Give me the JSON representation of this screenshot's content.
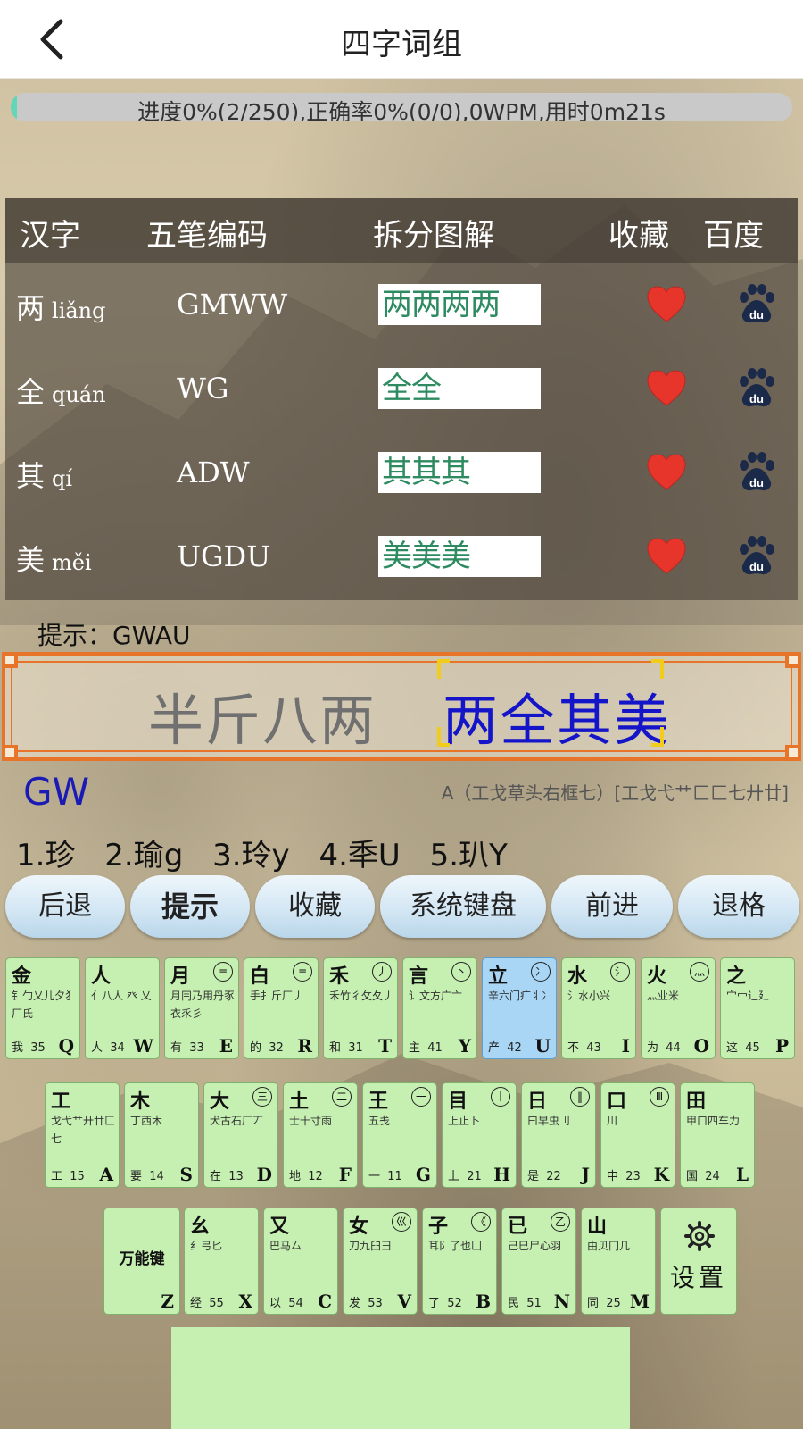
{
  "header": {
    "title": "四字词组"
  },
  "progress": {
    "text": "进度0%(2/250),正确率0%(0/0),0WPM,用时0m21s",
    "fraction": 0.008,
    "fill_color": "#62d6b7"
  },
  "table": {
    "headers": [
      "汉字",
      "五笔编码",
      "拆分图解",
      "收藏",
      "百度"
    ],
    "rows": [
      {
        "char": "两",
        "pinyin": "liǎng",
        "code": "GMWW",
        "parts": "两两两两"
      },
      {
        "char": "全",
        "pinyin": "quán",
        "code": "WG",
        "parts": "全全"
      },
      {
        "char": "其",
        "pinyin": "qí",
        "code": "ADW",
        "parts": "其其其"
      },
      {
        "char": "美",
        "pinyin": "měi",
        "code": "UGDU",
        "parts": "美美美"
      }
    ],
    "favorite_icon": "heart-icon",
    "baidu_icon": "baidu-paw-icon"
  },
  "hint": "提示：GWAU",
  "phrase": {
    "previous": "半斤八两",
    "current": "两全其美"
  },
  "input": {
    "typed": "GW",
    "root_hint": "A（工戈草头右框七）[工戈弋艹匚匚七廾廿]",
    "candidates": [
      "1.珍",
      "2.瑜g",
      "3.玲y",
      "4.秊U",
      "5.玐Y"
    ]
  },
  "actions": [
    "后退",
    "提示",
    "收藏",
    "系统键盘",
    "前进",
    "退格"
  ],
  "keyboard": {
    "row1": [
      {
        "name": "金",
        "circ": "",
        "roots": "钅勹乂儿夕犭厂氏",
        "foot": "我",
        "num": "35",
        "letter": "Q"
      },
      {
        "name": "人",
        "circ": "",
        "roots": "亻八人 癶 乂",
        "foot": "人",
        "num": "34",
        "letter": "W"
      },
      {
        "name": "月",
        "circ": "≡",
        "roots": "月冃乃用丹豕衣乑彡",
        "foot": "有",
        "num": "33",
        "letter": "E"
      },
      {
        "name": "白",
        "circ": "≡",
        "roots": "手扌斤厂丿",
        "foot": "的",
        "num": "32",
        "letter": "R"
      },
      {
        "name": "禾",
        "circ": "丿",
        "roots": "禾竹彳攵夂丿",
        "foot": "和",
        "num": "31",
        "letter": "T"
      },
      {
        "name": "言",
        "circ": "丶",
        "roots": "讠文方广亠",
        "foot": "主",
        "num": "41",
        "letter": "Y"
      },
      {
        "name": "立",
        "circ": "冫",
        "roots": "辛六门疒丬冫",
        "foot": "产",
        "num": "42",
        "letter": "U"
      },
      {
        "name": "水",
        "circ": "氵",
        "roots": "氵水小兴",
        "foot": "不",
        "num": "43",
        "letter": "I"
      },
      {
        "name": "火",
        "circ": "灬",
        "roots": "灬业米",
        "foot": "为",
        "num": "44",
        "letter": "O"
      },
      {
        "name": "之",
        "circ": "",
        "roots": "宀冖辶廴",
        "foot": "这",
        "num": "45",
        "letter": "P"
      }
    ],
    "row2": [
      {
        "name": "工",
        "circ": "",
        "roots": "戈弋艹廾廿匚七",
        "foot": "工",
        "num": "15",
        "letter": "A"
      },
      {
        "name": "木",
        "circ": "",
        "roots": "丁西木",
        "foot": "要",
        "num": "14",
        "letter": "S"
      },
      {
        "name": "大",
        "circ": "三",
        "roots": "犬古石厂丆",
        "foot": "在",
        "num": "13",
        "letter": "D"
      },
      {
        "name": "土",
        "circ": "二",
        "roots": "士十寸雨",
        "foot": "地",
        "num": "12",
        "letter": "F"
      },
      {
        "name": "王",
        "circ": "一",
        "roots": "五戋",
        "foot": "一",
        "num": "11",
        "letter": "G"
      },
      {
        "name": "目",
        "circ": "丨",
        "roots": "上止卜",
        "foot": "上",
        "num": "21",
        "letter": "H"
      },
      {
        "name": "日",
        "circ": "‖",
        "roots": "曰早虫刂",
        "foot": "是",
        "num": "22",
        "letter": "J"
      },
      {
        "name": "口",
        "circ": "Ⅲ",
        "roots": "川",
        "foot": "中",
        "num": "23",
        "letter": "K"
      },
      {
        "name": "田",
        "circ": "",
        "roots": "甲口四车力",
        "foot": "国",
        "num": "24",
        "letter": "L"
      }
    ],
    "row3": [
      {
        "name": "幺",
        "circ": "",
        "roots": "纟弓匕",
        "foot": "经",
        "num": "55",
        "letter": "X"
      },
      {
        "name": "又",
        "circ": "",
        "roots": "巴马厶",
        "foot": "以",
        "num": "54",
        "letter": "C"
      },
      {
        "name": "女",
        "circ": "巛",
        "roots": "刀九臼彐",
        "foot": "发",
        "num": "53",
        "letter": "V"
      },
      {
        "name": "子",
        "circ": "《",
        "roots": "耳阝了也凵",
        "foot": "了",
        "num": "52",
        "letter": "B"
      },
      {
        "name": "已",
        "circ": "乙",
        "roots": "己巳尸心羽",
        "foot": "民",
        "num": "51",
        "letter": "N"
      },
      {
        "name": "山",
        "circ": "",
        "roots": "由贝冂几",
        "foot": "同",
        "num": "25",
        "letter": "M"
      }
    ],
    "wanneng": {
      "label": "万能键",
      "letter": "Z"
    },
    "settings": {
      "label": "设置",
      "icon": "gear-icon"
    }
  }
}
